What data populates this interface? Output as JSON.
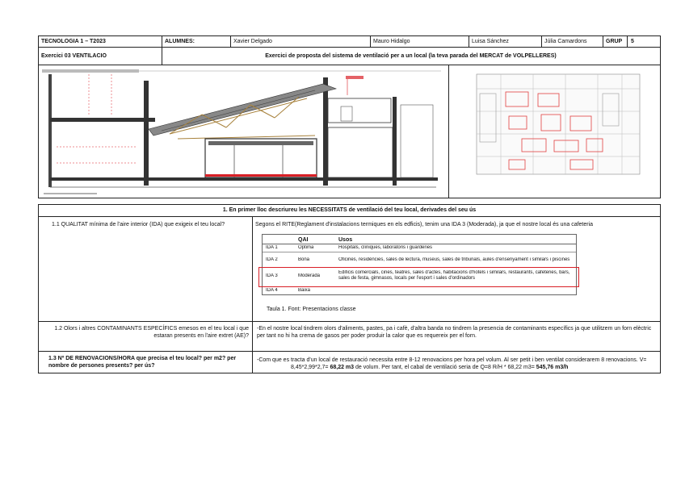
{
  "header": {
    "course": "TECNOLOGIA 1 – T2023",
    "students_label": "ALUMNES:",
    "students": [
      "Xavier Delgado",
      "Mauro Hidalgo",
      "Luisa Sánchez",
      "Júlia Camardons"
    ],
    "group_label": "GRUP",
    "group_value": "5",
    "exercise": "Exercici 03 VENTILACIÓ",
    "exercise_title": "Exercici de proposta del sistema de ventilació per a un local (la teva parada del MERCAT de VOLPELLERES)"
  },
  "section": {
    "title": "1.    En primer lloc descriureu les NECESSITATS de ventilació del teu local, derivades del seu ús"
  },
  "q1": {
    "question": "1.1 QUALITAT mínima de l'aire interior (IDA) que exigeix el teu local?",
    "answer": "Segons el RITE(Reglament d'instalacions termiques en els edficis), tenim una IDA 3 (Moderada), ja que el nostre local és una cafeteria",
    "table": {
      "headers": [
        "QAI",
        "Usos"
      ],
      "rows": [
        {
          "code": "IDA 1",
          "qai": "Òptima",
          "usos": "Hospitals, clíniques, laboratoris i guarderies"
        },
        {
          "code": "IDA 2",
          "qai": "Bona",
          "usos": "Oficines, residències, sales de lectura, museus, sales de tribunals, aules d'ensenyament i similars i piscines"
        },
        {
          "code": "IDA 3",
          "qai": "Moderada",
          "usos": "Edificis comercials, cines, teatres, sales d'actes, habitacions d'hotels i similars, restaurants, cafeteries, bars, sales de festa, gimnasos, locals per l'esport i sales d'ordinadors"
        },
        {
          "code": "IDA 4",
          "qai": "Baixa",
          "usos": ""
        }
      ],
      "caption": "Taula 1. Font: Presentacions classe"
    }
  },
  "q2": {
    "question": "1.2 Olors i altres CONTAMINANTS ESPECÍFICS emesos en el teu local i que estaran presents en l'aire extret (AE)?",
    "answer": "-En el nostre local tindrem olors d'aliments, pastes, pa i cafè, d'altra banda no tindrem la presencia de contaminants específics  ja que utilitzem un forn elèctric per tant no hi ha crema de gasos per poder produir la calor que es requereix per el forn."
  },
  "q3": {
    "question": "1.3 Nº DE RENOVACIONS/HORA que precisa el teu local? per m2? per nombre de persones presents? per ús?",
    "answer_line1": "-Com que es tracta d'un local de restauració necessita entre 8-12 renovacions per hora pel volum. Al ser petit i ben ventilat considerarem 8 renovacions. V=",
    "answer_line2_a": "8,45*2,99*2,7= ",
    "answer_line2_b": "68,22 m3",
    "answer_line2_c": " de volum. Per tant, el cabal de ventilació seria de  Q=8 R/H * 68,22 m3= ",
    "answer_line2_d": "545,76 m3/h"
  },
  "colors": {
    "highlight": "#d91f26",
    "plan_red": "#e04040",
    "border": "#222222"
  }
}
